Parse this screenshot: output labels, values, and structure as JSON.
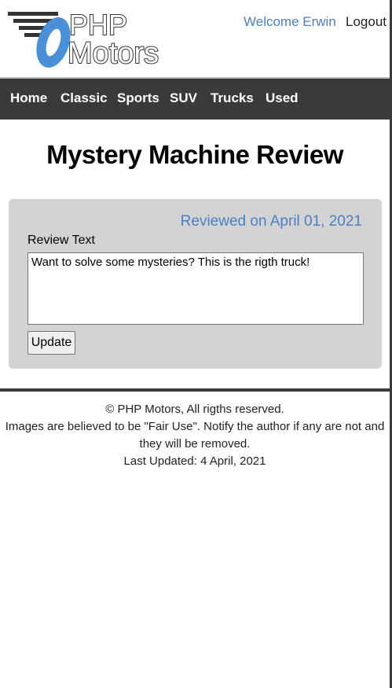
{
  "header": {
    "logo_top": "PHP",
    "logo_bottom": "Motors",
    "welcome": "Welcome Erwin",
    "logout": "Logout"
  },
  "nav": {
    "items": [
      {
        "label": "Home"
      },
      {
        "label": "Classic"
      },
      {
        "label": "Sports"
      },
      {
        "label": "SUV"
      },
      {
        "label": "Trucks"
      },
      {
        "label": "Used"
      }
    ]
  },
  "main": {
    "title": "Mystery Machine Review",
    "reviewed_on": "Reviewed on April 01, 2021",
    "review_label": "Review Text",
    "review_text": "Want to solve some mysteries? This is the rigth truck!",
    "update_label": "Update"
  },
  "footer": {
    "copyright": "© PHP Motors, All rigths reserved.",
    "fair_use": "Images are believed to be \"Fair Use\". Notify the author if any are not and they will be removed.",
    "last_updated": "Last Updated: 4 April, 2021"
  },
  "colors": {
    "accent_blue": "#4a7fc4",
    "nav_background": "#3a3a3a",
    "card_background": "#d3d3d3"
  }
}
